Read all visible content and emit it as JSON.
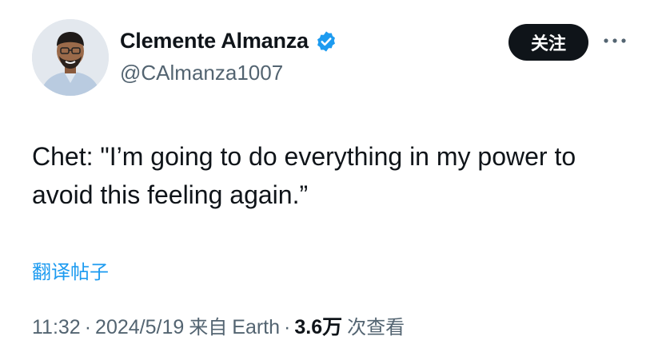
{
  "author": {
    "display_name": "Clemente Almanza",
    "handle": "@CAlmanza1007",
    "verified": true,
    "verified_icon": "verified-badge-icon",
    "avatar_icon": "avatar"
  },
  "actions": {
    "follow_label": "关注",
    "more_icon": "more-horizontal-icon"
  },
  "tweet": {
    "text": "Chet: \"I’m going to do everything in my power to avoid this feeling again.”",
    "translate_label": "翻译帖子"
  },
  "meta": {
    "time": "11:32",
    "date": "2024/5/19",
    "source_prefix": "来自",
    "source": "Earth",
    "views_count": "3.6万",
    "views_label": "次查看",
    "separator": "·"
  },
  "colors": {
    "accent": "#1d9bf0",
    "text": "#0f1419",
    "secondary": "#536471",
    "button_bg": "#0f1419"
  }
}
